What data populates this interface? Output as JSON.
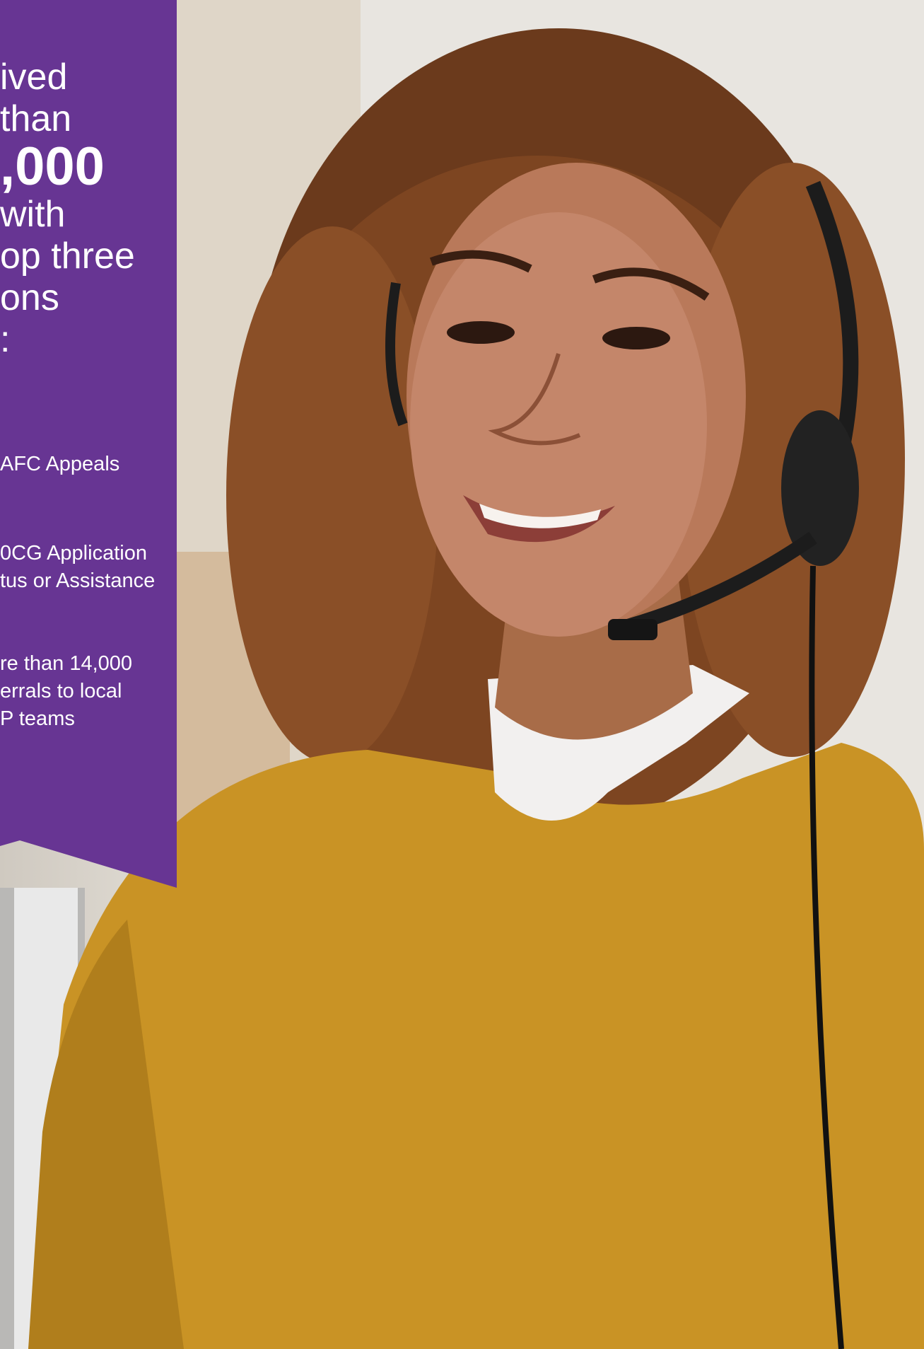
{
  "panel": {
    "color": "#673593",
    "headline_lines": [
      "ived",
      "than",
      ",000",
      "with",
      "op three",
      "ons",
      ":"
    ],
    "items": [
      {
        "lines": [
          "AFC Appeals"
        ]
      },
      {
        "lines": [
          "0CG Application",
          "tus or Assistance"
        ]
      },
      {
        "lines": [
          "re than 14,000",
          "errals to local",
          "P teams"
        ]
      }
    ]
  },
  "photo": {
    "subject": "smiling woman wearing a headset and mustard-yellow sweater"
  }
}
